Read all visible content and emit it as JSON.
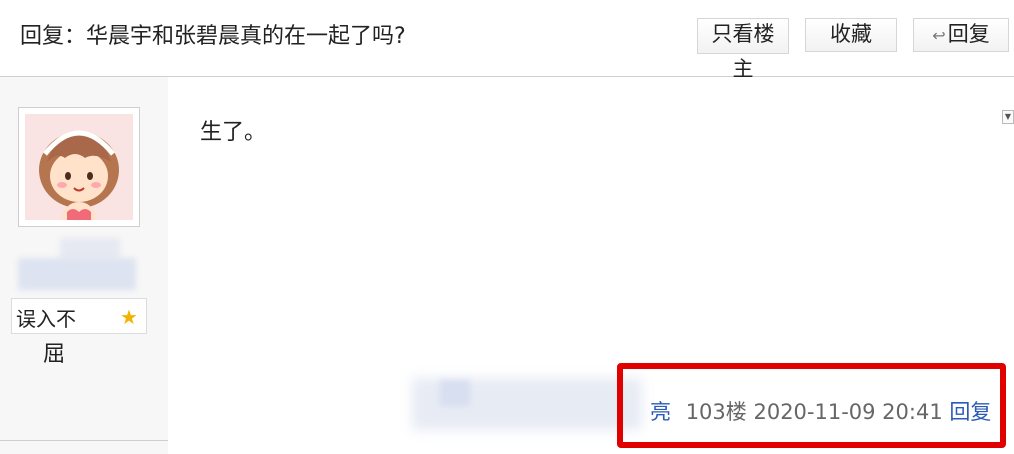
{
  "header": {
    "title": "回复：华晨宇和张碧晨真的在一起了吗?",
    "buttons": {
      "only_owner_line1": "只看楼",
      "only_owner_line2": "主",
      "favorite": "收藏",
      "reply": "回复"
    }
  },
  "user": {
    "badge_line1": "误入不",
    "badge_line2": "屈"
  },
  "post": {
    "content": "生了。",
    "meta_prefix": "亮",
    "floor": "103楼",
    "timestamp": "2020-11-09 20:41",
    "reply_link": "回复"
  },
  "colors": {
    "highlight": "#e00000",
    "link": "#2a5bb8"
  }
}
